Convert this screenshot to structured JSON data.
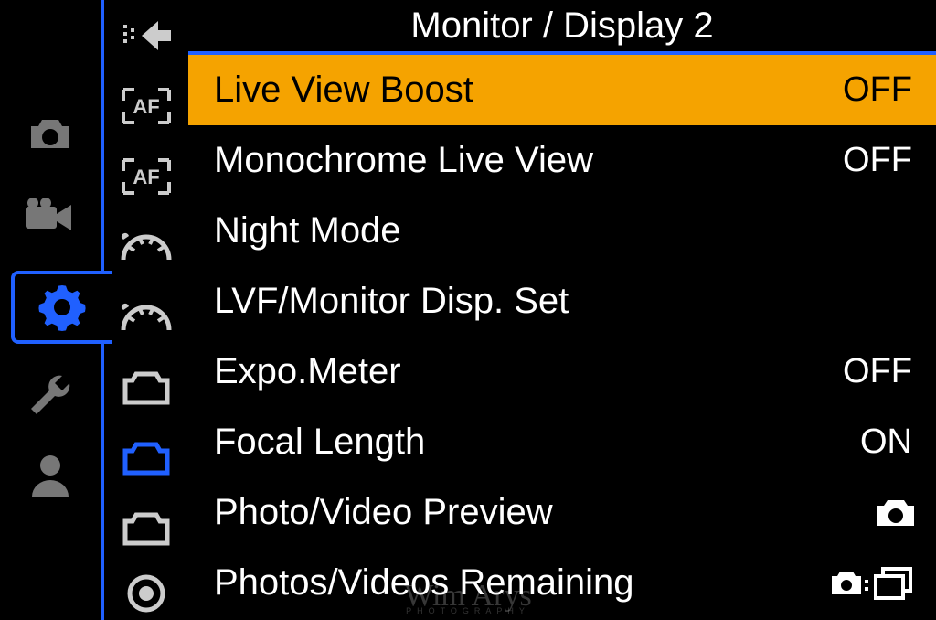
{
  "header": {
    "title": "Monitor / Display 2"
  },
  "mainTabs": [
    {
      "name": "camera",
      "active": false
    },
    {
      "name": "video",
      "active": false
    },
    {
      "name": "gear",
      "active": true
    },
    {
      "name": "wrench",
      "active": false
    },
    {
      "name": "person",
      "active": false
    }
  ],
  "subIcons": [
    {
      "name": "back-arrow",
      "active": false
    },
    {
      "name": "af1",
      "active": false
    },
    {
      "name": "af2",
      "active": false
    },
    {
      "name": "dial1",
      "active": false
    },
    {
      "name": "dial2",
      "active": false
    },
    {
      "name": "monitor1",
      "active": false
    },
    {
      "name": "monitor2",
      "active": true
    },
    {
      "name": "monitor3",
      "active": false
    },
    {
      "name": "lens",
      "active": false
    }
  ],
  "menu": [
    {
      "label": "Live View Boost",
      "value": "OFF",
      "valueType": "text",
      "selected": true
    },
    {
      "label": "Monochrome Live View",
      "value": "OFF",
      "valueType": "text",
      "selected": false
    },
    {
      "label": "Night Mode",
      "value": "",
      "valueType": "none",
      "selected": false
    },
    {
      "label": "LVF/Monitor Disp. Set",
      "value": "",
      "valueType": "none",
      "selected": false
    },
    {
      "label": "Expo.Meter",
      "value": "OFF",
      "valueType": "text",
      "selected": false
    },
    {
      "label": "Focal Length",
      "value": "ON",
      "valueType": "text",
      "selected": false
    },
    {
      "label": "Photo/Video Preview",
      "value": "camera",
      "valueType": "icon-camera",
      "selected": false
    },
    {
      "label": "Photos/Videos Remaining",
      "value": "camera-stack",
      "valueType": "icon-camera-stack",
      "selected": false
    }
  ],
  "colors": {
    "accent": "#2060ff",
    "highlight": "#f5a300"
  },
  "watermark": {
    "text": "Wim Arys",
    "sub": "PHOTOGRAPHY"
  }
}
